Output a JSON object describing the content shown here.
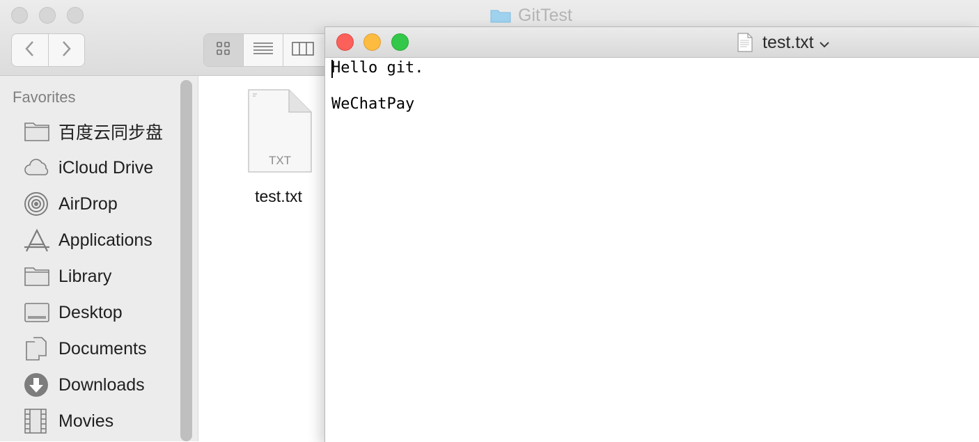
{
  "finder": {
    "title": "GitTest",
    "sidebar": {
      "heading": "Favorites",
      "items": [
        {
          "label": "百度云同步盘",
          "icon": "folder-icon"
        },
        {
          "label": "iCloud Drive",
          "icon": "cloud-icon"
        },
        {
          "label": "AirDrop",
          "icon": "airdrop-icon"
        },
        {
          "label": "Applications",
          "icon": "applications-icon"
        },
        {
          "label": "Library",
          "icon": "folder-icon"
        },
        {
          "label": "Desktop",
          "icon": "desktop-icon"
        },
        {
          "label": "Documents",
          "icon": "documents-icon"
        },
        {
          "label": "Downloads",
          "icon": "downloads-icon"
        },
        {
          "label": "Movies",
          "icon": "movies-icon"
        }
      ]
    },
    "file": {
      "name": "test.txt",
      "badge": "TXT"
    }
  },
  "textedit": {
    "title": "test.txt",
    "lines": [
      "Hello git.",
      "",
      "WeChatPay"
    ]
  },
  "colors": {
    "close": "#fc605b",
    "minimize": "#fdbc40",
    "zoom": "#34c84a",
    "folder_blue": "#9fd2ef"
  }
}
